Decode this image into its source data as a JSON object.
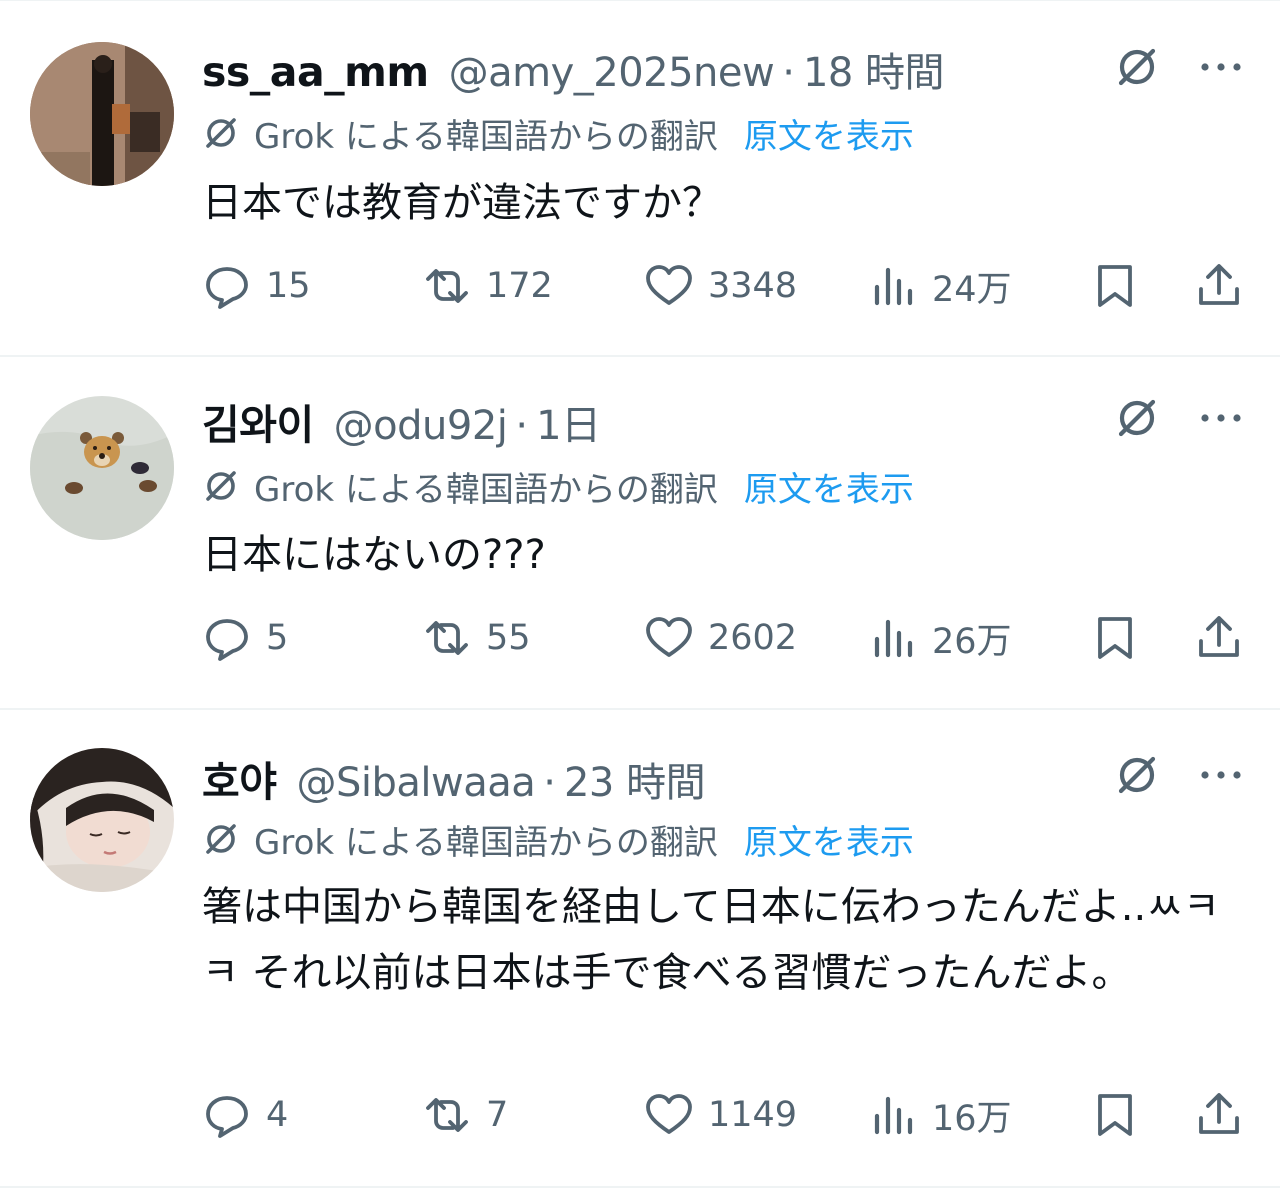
{
  "tweets": [
    {
      "name": "ss_aa_mm",
      "handle": "@amy_2025new",
      "time": "18 時間",
      "translation_label": "Grok による韓国語からの翻訳",
      "show_original": "原文を表示",
      "text": "日本では教育が違法ですか？",
      "replies": "15",
      "retweets": "172",
      "likes": "3348",
      "views": "24万"
    },
    {
      "name": "김와이",
      "handle": "@odu92j",
      "time": "1日",
      "translation_label": "Grok による韓国語からの翻訳",
      "show_original": "原文を表示",
      "text": "日本にはないの???",
      "replies": "5",
      "retweets": "55",
      "likes": "2602",
      "views": "26万"
    },
    {
      "name": "호야",
      "handle": "@Sibalwaaa",
      "time": "23 時間",
      "translation_label": "Grok による韓国語からの翻訳",
      "show_original": "原文を表示",
      "text": "箸は中国から韓国を経由して日本に伝わったんだよ..ㅆㅋㅋ それ以前は日本は手で食べる習慣だったんだよ。",
      "replies": "4",
      "retweets": "7",
      "likes": "1149",
      "views": "16万"
    }
  ],
  "separator": "·",
  "colors": {
    "text_primary": "#0f1419",
    "text_secondary": "#536471",
    "link": "#1d9bf0",
    "divider": "#eff3f4"
  },
  "icons": {
    "grok": "grok-icon",
    "more": "more-icon",
    "reply": "reply-icon",
    "retweet": "retweet-icon",
    "like": "like-icon",
    "views": "views-icon",
    "bookmark": "bookmark-icon",
    "share": "share-icon"
  }
}
